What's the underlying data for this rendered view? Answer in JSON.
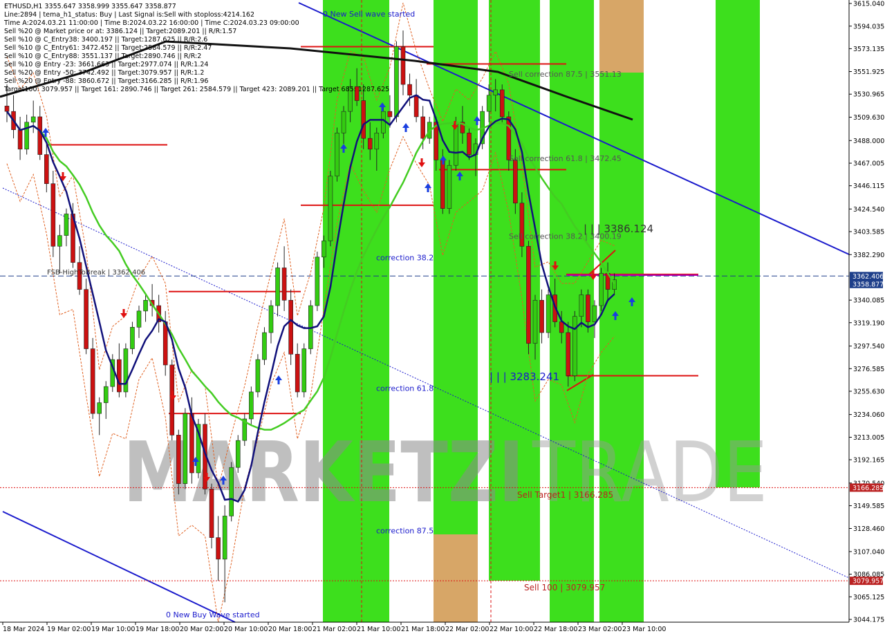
{
  "info_panel": [
    "ETHUSD,H1  3355.647 3358.999 3355.647 3358.877",
    "Line:2894 | tema_h1_status: Buy | Last Signal is:Sell with stoploss:4214.162",
    "Time A:2024.03.21 11:00:00 | Time B:2024.03.22 16:00:00 | Time C:2024.03.23 09:00:00",
    "Sell %20 @ Market price or at: 3386.124 || Target:2089.201 || R/R:1.57",
    "Sell %10 @ C_Entry38: 3400.197 || Target:1287.625 || R/R:2.6",
    "Sell %10 @ C_Entry61: 3472.452 || Target:2584.579 || R/R:2.47",
    "Sell %10 @ C_Entry88: 3551.137 || Target:2890.746 || R/R:2",
    "Sell %10 @ Entry -23: 3661.663 || Target:2977.074 || R/R:1.24",
    "Sell %20 @ Entry -50: 3742.492 || Target:3079.957 || R/R:1.2",
    "Sell %20 @ Entry -88: 3860.672 || Target:3166.285 || R/R:1.96",
    "Target100: 3079.957 || Target 161: 2890.746 || Target 261: 2584.579 || Target 423: 2089.201 || Target 685: 1287.625"
  ],
  "watermark": {
    "left": "MARKETZI",
    "right": "TRADE"
  },
  "colors": {
    "zone_green": "#33dd11",
    "zone_orange": "#e8a070",
    "bull_candle": "#33cc11",
    "bear_candle": "#cc1111",
    "ema_dark_blue": "#10107a",
    "ma_green": "#44cc22",
    "ma_black": "#111111",
    "trend_blue": "#1a1acc",
    "level_red": "#dd1111",
    "price_blue": "#1e3f8a",
    "label_red": "#bb2222"
  },
  "chart_data": {
    "type": "candlestick",
    "symbol": "ETHUSD",
    "timeframe": "H1",
    "ylim": [
      3044.175,
      3615.04
    ],
    "y_ticks": [
      "3615.040",
      "3594.035",
      "3573.135",
      "3551.925",
      "3530.965",
      "3509.630",
      "3488.000",
      "3467.005",
      "3446.115",
      "3424.540",
      "3403.585",
      "3382.290",
      "3340.085",
      "3319.190",
      "3297.540",
      "3276.585",
      "3255.630",
      "3234.060",
      "3213.005",
      "3192.165",
      "3170.540",
      "3149.585",
      "3128.460",
      "3107.040",
      "3086.085",
      "3065.125",
      "3044.175"
    ],
    "x_ticks": [
      "18 Mar 2024",
      "19 Mar 02:00",
      "19 Mar 10:00",
      "19 Mar 18:00",
      "20 Mar 02:00",
      "20 Mar 10:00",
      "20 Mar 18:00",
      "21 Mar 02:00",
      "21 Mar 10:00",
      "21 Mar 18:00",
      "22 Mar 02:00",
      "22 Mar 10:00",
      "22 Mar 18:00",
      "23 Mar 02:00",
      "23 Mar 10:00"
    ],
    "price_tags": [
      {
        "value": "3362.406",
        "price": 3362.406,
        "color": "#1e3f8a"
      },
      {
        "value": "3358.877",
        "price": 3358.877,
        "color": "#1e3f8a"
      },
      {
        "value": "3166.285",
        "price": 3166.285,
        "color": "#bb2222"
      },
      {
        "value": "3079.957",
        "price": 3079.957,
        "color": "#bb2222"
      }
    ],
    "annotations": [
      {
        "text": "0 New Sell wave started",
        "price": 3603,
        "color": "#1a1acc",
        "size": 11
      },
      {
        "text": "Sell correction 87.5 | 3551.13",
        "price": 3547,
        "color": "#555555",
        "size": 11
      },
      {
        "text": "Sell correction 61.8 | 3472.45",
        "price": 3469,
        "color": "#555555",
        "size": 11
      },
      {
        "text": "Sell correction 38.2 | 3400.19",
        "price": 3397,
        "color": "#555555",
        "size": 11
      },
      {
        "text": "| | | 3386.124",
        "price": 3403,
        "color": "#333333",
        "size": 15
      },
      {
        "text": "FSB-HighToBreak | 3362.406",
        "price": 3364,
        "color": "#333333",
        "size": 10
      },
      {
        "text": "correction 38.2",
        "price": 3377,
        "color": "#1a1acc",
        "size": 11
      },
      {
        "text": "correction 61.8",
        "price": 3256,
        "color": "#1a1acc",
        "size": 11
      },
      {
        "text": "correction 87.5",
        "price": 3124,
        "color": "#1a1acc",
        "size": 11
      },
      {
        "text": "| | | 3283.241",
        "price": 3266,
        "color": "#1a1acc",
        "size": 15
      },
      {
        "text": "Sell Target1 | 3166.285",
        "price": 3157,
        "color": "#bb2222",
        "size": 12
      },
      {
        "text": "Sell 100 | 3079.957",
        "price": 3071,
        "color": "#bb2222",
        "size": 12
      },
      {
        "text": "0 New Buy Wave started",
        "price": 3046,
        "color": "#1a1acc",
        "size": 11
      }
    ],
    "candles": [
      [
        3520,
        3540,
        3505,
        3515
      ],
      [
        3515,
        3530,
        3490,
        3498
      ],
      [
        3498,
        3510,
        3470,
        3480
      ],
      [
        3480,
        3512,
        3475,
        3505
      ],
      [
        3505,
        3525,
        3495,
        3510
      ],
      [
        3510,
        3520,
        3470,
        3475
      ],
      [
        3475,
        3485,
        3440,
        3448
      ],
      [
        3448,
        3460,
        3380,
        3390
      ],
      [
        3390,
        3410,
        3365,
        3400
      ],
      [
        3400,
        3425,
        3390,
        3420
      ],
      [
        3420,
        3430,
        3370,
        3375
      ],
      [
        3375,
        3390,
        3345,
        3350
      ],
      [
        3350,
        3360,
        3290,
        3295
      ],
      [
        3295,
        3305,
        3230,
        3235
      ],
      [
        3235,
        3250,
        3215,
        3245
      ],
      [
        3245,
        3265,
        3230,
        3260
      ],
      [
        3260,
        3290,
        3255,
        3285
      ],
      [
        3285,
        3300,
        3250,
        3255
      ],
      [
        3255,
        3300,
        3250,
        3295
      ],
      [
        3295,
        3320,
        3290,
        3315
      ],
      [
        3315,
        3335,
        3305,
        3330
      ],
      [
        3330,
        3345,
        3320,
        3340
      ],
      [
        3340,
        3355,
        3325,
        3335
      ],
      [
        3335,
        3345,
        3310,
        3320
      ],
      [
        3320,
        3330,
        3270,
        3280
      ],
      [
        3280,
        3285,
        3210,
        3215
      ],
      [
        3215,
        3220,
        3160,
        3170
      ],
      [
        3170,
        3240,
        3165,
        3235
      ],
      [
        3235,
        3250,
        3170,
        3180
      ],
      [
        3180,
        3230,
        3175,
        3225
      ],
      [
        3225,
        3235,
        3160,
        3165
      ],
      [
        3165,
        3170,
        3110,
        3120
      ],
      [
        3120,
        3140,
        3080,
        3100
      ],
      [
        3100,
        3150,
        3060,
        3140
      ],
      [
        3140,
        3190,
        3135,
        3185
      ],
      [
        3185,
        3215,
        3180,
        3210
      ],
      [
        3210,
        3235,
        3205,
        3230
      ],
      [
        3230,
        3260,
        3225,
        3255
      ],
      [
        3255,
        3290,
        3250,
        3285
      ],
      [
        3285,
        3315,
        3280,
        3310
      ],
      [
        3310,
        3340,
        3300,
        3335
      ],
      [
        3335,
        3375,
        3325,
        3370
      ],
      [
        3370,
        3390,
        3330,
        3340
      ],
      [
        3340,
        3350,
        3280,
        3290
      ],
      [
        3290,
        3300,
        3250,
        3255
      ],
      [
        3255,
        3300,
        3250,
        3295
      ],
      [
        3295,
        3340,
        3290,
        3335
      ],
      [
        3335,
        3385,
        3330,
        3380
      ],
      [
        3380,
        3400,
        3370,
        3395
      ],
      [
        3395,
        3460,
        3390,
        3455
      ],
      [
        3455,
        3500,
        3450,
        3495
      ],
      [
        3495,
        3520,
        3485,
        3515
      ],
      [
        3515,
        3545,
        3505,
        3538
      ],
      [
        3538,
        3555,
        3520,
        3525
      ],
      [
        3525,
        3540,
        3480,
        3490
      ],
      [
        3490,
        3505,
        3470,
        3480
      ],
      [
        3480,
        3500,
        3460,
        3495
      ],
      [
        3495,
        3520,
        3490,
        3515
      ],
      [
        3515,
        3530,
        3500,
        3510
      ],
      [
        3510,
        3580,
        3505,
        3575
      ],
      [
        3575,
        3590,
        3530,
        3540
      ],
      [
        3540,
        3550,
        3520,
        3530
      ],
      [
        3530,
        3545,
        3505,
        3510
      ],
      [
        3510,
        3520,
        3480,
        3490
      ],
      [
        3490,
        3510,
        3485,
        3505
      ],
      [
        3505,
        3510,
        3460,
        3470
      ],
      [
        3470,
        3480,
        3420,
        3425
      ],
      [
        3425,
        3470,
        3420,
        3465
      ],
      [
        3465,
        3510,
        3460,
        3505
      ],
      [
        3505,
        3520,
        3485,
        3495
      ],
      [
        3495,
        3500,
        3470,
        3475
      ],
      [
        3475,
        3490,
        3455,
        3485
      ],
      [
        3485,
        3520,
        3480,
        3515
      ],
      [
        3515,
        3540,
        3505,
        3530
      ],
      [
        3530,
        3545,
        3515,
        3535
      ],
      [
        3535,
        3540,
        3505,
        3510
      ],
      [
        3510,
        3515,
        3460,
        3470
      ],
      [
        3470,
        3480,
        3420,
        3430
      ],
      [
        3430,
        3440,
        3380,
        3390
      ],
      [
        3390,
        3395,
        3290,
        3300
      ],
      [
        3300,
        3345,
        3285,
        3340
      ],
      [
        3340,
        3350,
        3300,
        3310
      ],
      [
        3310,
        3350,
        3305,
        3345
      ],
      [
        3345,
        3360,
        3315,
        3320
      ],
      [
        3320,
        3330,
        3300,
        3310
      ],
      [
        3310,
        3320,
        3260,
        3270
      ],
      [
        3270,
        3330,
        3265,
        3325
      ],
      [
        3325,
        3350,
        3315,
        3345
      ],
      [
        3345,
        3350,
        3310,
        3320
      ],
      [
        3320,
        3340,
        3305,
        3335
      ],
      [
        3335,
        3370,
        3330,
        3365
      ],
      [
        3365,
        3375,
        3340,
        3350
      ],
      [
        3350,
        3365,
        3345,
        3359
      ]
    ]
  }
}
